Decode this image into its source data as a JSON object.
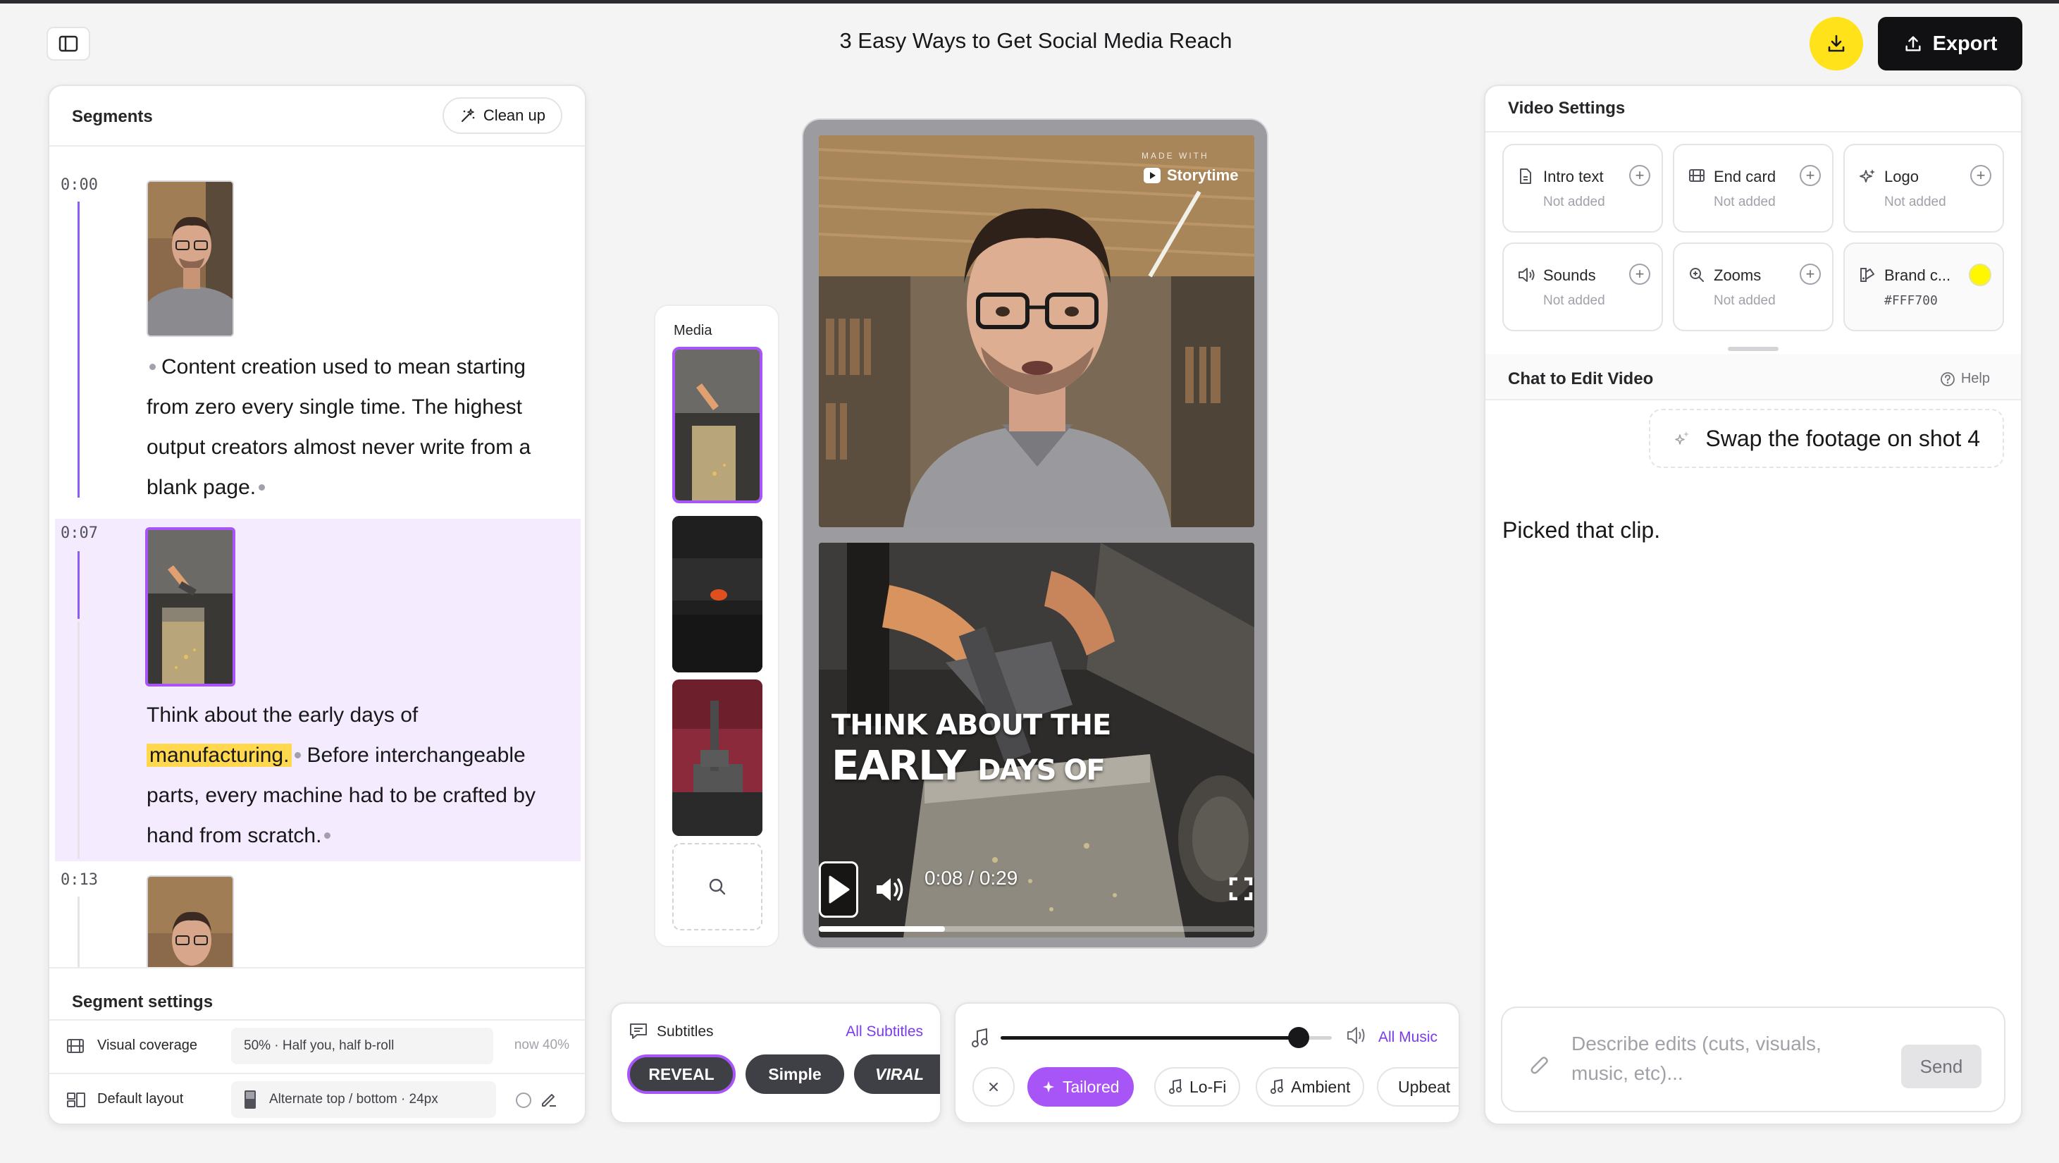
{
  "header": {
    "title": "3 Easy Ways to Get Social Media Reach",
    "export_label": "Export"
  },
  "segments": {
    "title": "Segments",
    "cleanup_label": "Clean up",
    "items": [
      {
        "time": "0:00",
        "text": "Content creation used to mean starting from zero every single time. The highest output creators almost never write from a blank page."
      },
      {
        "time": "0:07",
        "text_before": "Think about the early days of",
        "highlight": "manufacturing.",
        "text_after": "Before interchangeable parts, every machine had to be crafted by hand from scratch."
      },
      {
        "time": "0:13"
      }
    ],
    "settings": {
      "title": "Segment settings",
      "visual_coverage_label": "Visual coverage",
      "visual_coverage_value": "50% · Half you, half b-roll",
      "visual_coverage_note": "now 40%",
      "default_layout_label": "Default layout",
      "default_layout_value": "Alternate top / bottom · 24px"
    }
  },
  "media": {
    "label": "Media"
  },
  "preview": {
    "watermark_small": "MADE WITH",
    "watermark_brand": "Storytime",
    "caption_line1": "THINK ABOUT THE",
    "caption_line2_big": "EARLY",
    "caption_line2_small": "DAYS OF",
    "time_display": "0:08 / 0:29",
    "progress": 0.29
  },
  "subtitles": {
    "title": "Subtitles",
    "link": "All Subtitles",
    "styles": [
      "REVEAL",
      "Simple",
      "VIRAL"
    ]
  },
  "music": {
    "link": "All Music",
    "volume": 0.9,
    "chips": [
      "Tailored",
      "Lo-Fi",
      "Ambient",
      "Upbeat"
    ]
  },
  "video_settings": {
    "title": "Video Settings",
    "cards": [
      {
        "title": "Intro text",
        "sub": "Not added",
        "icon": "document-icon"
      },
      {
        "title": "End card",
        "sub": "Not added",
        "icon": "film-icon"
      },
      {
        "title": "Logo",
        "sub": "Not added",
        "icon": "sparkle-icon"
      },
      {
        "title": "Sounds",
        "sub": "Not added",
        "icon": "speaker-icon"
      },
      {
        "title": "Zooms",
        "sub": "Not added",
        "icon": "zoom-icon"
      },
      {
        "title": "Brand c...",
        "sub": "#FFF700",
        "icon": "palette-icon"
      }
    ],
    "brand_color": "#FFF700"
  },
  "chat": {
    "title": "Chat to Edit Video",
    "help": "Help",
    "user_message": "Swap the footage on shot 4",
    "bot_message": "Picked that clip.",
    "input_placeholder": "Describe edits (cuts, visuals, music, etc)...",
    "send_label": "Send"
  },
  "colors": {
    "accent_yellow": "#FFE21A",
    "accent_purple": "#a855f7",
    "link_purple": "#7c3aed",
    "highlight": "#FFD84D",
    "active_segment_bg": "#f4ecfe"
  }
}
